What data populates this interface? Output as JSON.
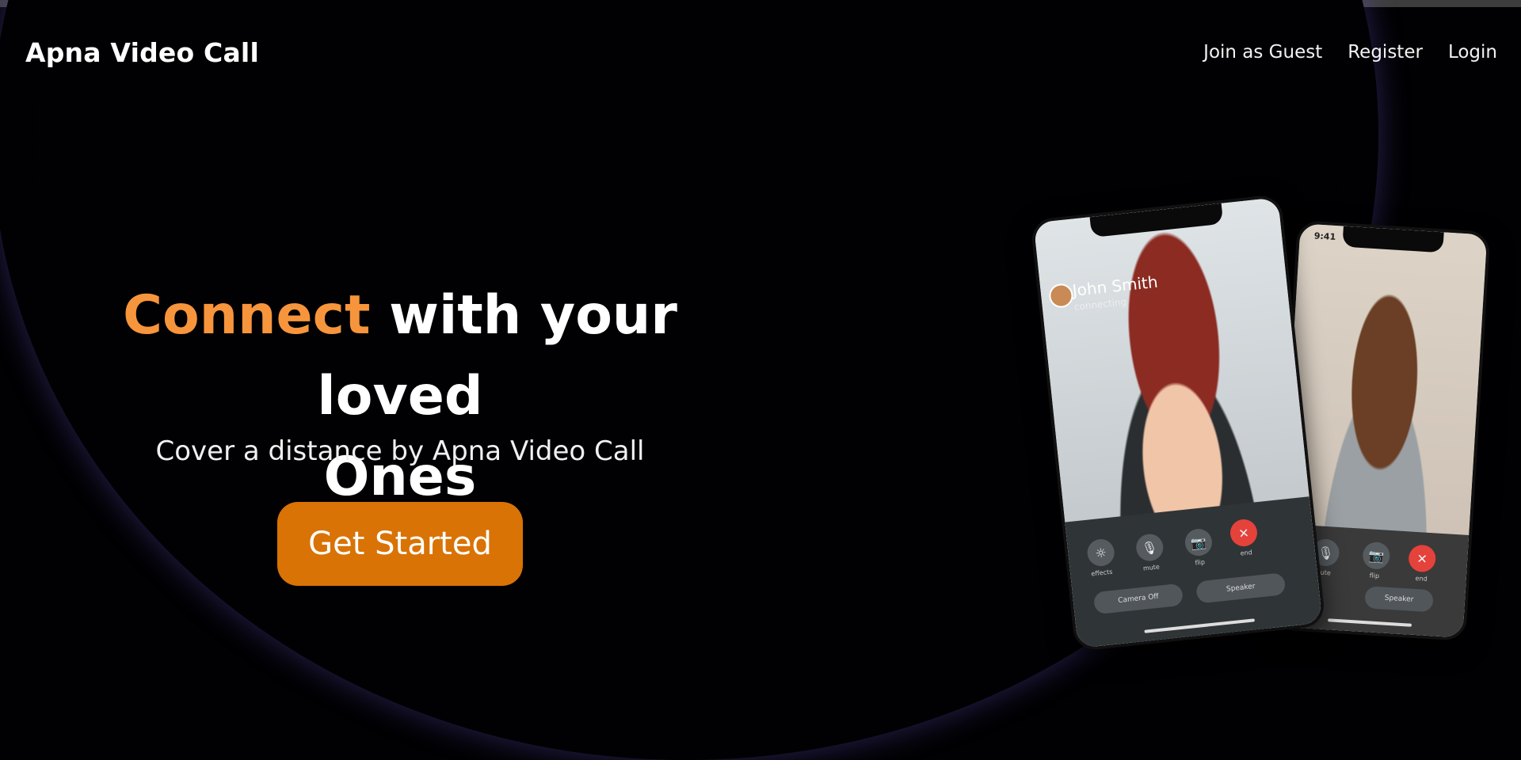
{
  "nav": {
    "brand": "Apna Video Call",
    "links": [
      {
        "label": "Join as Guest"
      },
      {
        "label": "Register"
      },
      {
        "label": "Login"
      }
    ]
  },
  "hero": {
    "title_accent": "Connect",
    "title_rest_line1": " with your loved",
    "title_line2": "Ones",
    "subtitle": "Cover a distance by Apna Video Call",
    "cta_label": "Get Started"
  },
  "phones": {
    "front": {
      "caller_name": "John Smith",
      "caller_status": "connecting",
      "controls": [
        "effects",
        "mute",
        "flip",
        "end"
      ],
      "pill_left": "Camera Off",
      "pill_right": "Speaker"
    },
    "back": {
      "time": "9:41",
      "controls": [
        "mute",
        "flip",
        "end"
      ],
      "pill_right": "Speaker"
    }
  },
  "colors": {
    "accent_text": "#f7953c",
    "cta_bg": "#d97306",
    "background": "#010103",
    "glow": "#8a7ee8"
  }
}
